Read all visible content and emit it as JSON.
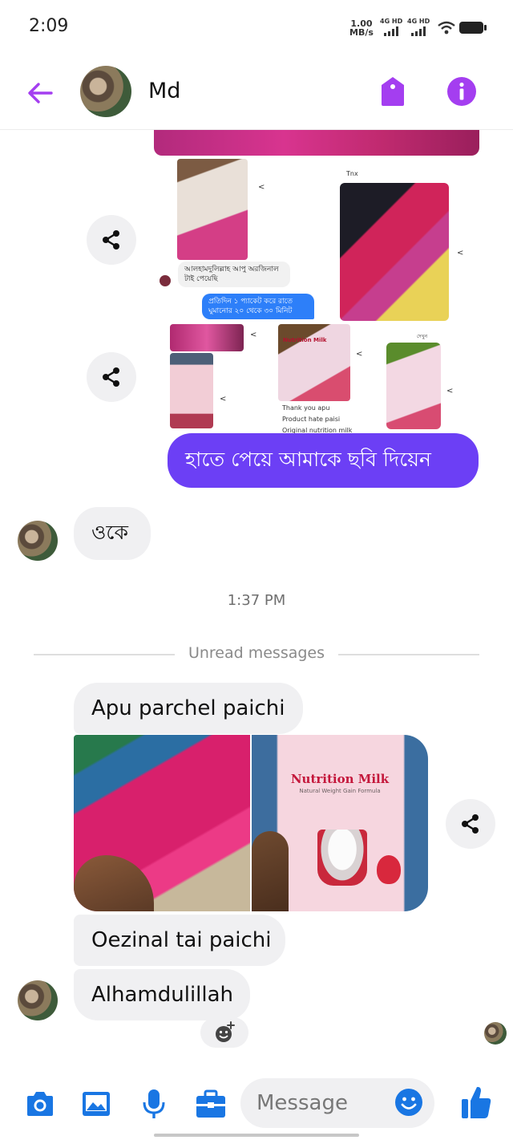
{
  "status_bar": {
    "time": "2:09",
    "net_speed_value": "1.00",
    "net_speed_unit": "MB/s",
    "signal_1": "4G HD",
    "signal_2": "4G HD"
  },
  "header": {
    "contact_name": "Md",
    "icons": [
      "back-arrow-icon",
      "tag-icon",
      "info-icon"
    ],
    "accent_color": "#a43ef0"
  },
  "shared_screenshot_a": {
    "reply_label": "Tnx",
    "bengali_bubble": "আলহামদুলিল্লাহ আপু অরজিনাল টাই পেয়েছি",
    "blue_bubble": "প্রতিদিন ১ প্যাকেট করে রাতে ঘুমানোর ২০ থেকে ৩০ মিনিট"
  },
  "shared_screenshot_b": {
    "box_label": "Nutrition Milk",
    "line_1": "Thank you apu",
    "line_2": "Product hate paisi",
    "line_3": "Original nutrition milk",
    "corner_label": "দেখুন"
  },
  "messages": {
    "outgoing_1": "হাতে পেয়ে আমাকে ছবি দিয়েন",
    "incoming_ok": "ওকে",
    "timestamp": "1:37 PM",
    "unread_divider": "Unread messages",
    "incoming_1": "Apu parchel paichi",
    "incoming_2": "Oezinal tai paichi",
    "incoming_3": "Alhamdulillah"
  },
  "media_photo": {
    "box_title": "Nutrition Milk",
    "box_subtitle": "Natural Weight Gain Formula"
  },
  "composer": {
    "placeholder": "Message",
    "icons": [
      "camera-icon",
      "gallery-icon",
      "microphone-icon",
      "briefcase-icon",
      "emoji-icon",
      "thumbs-up-icon"
    ],
    "icon_color": "#1976e3"
  },
  "colors": {
    "outgoing_bubble": "#6c3ff5",
    "incoming_bubble": "#f0f0f2"
  }
}
